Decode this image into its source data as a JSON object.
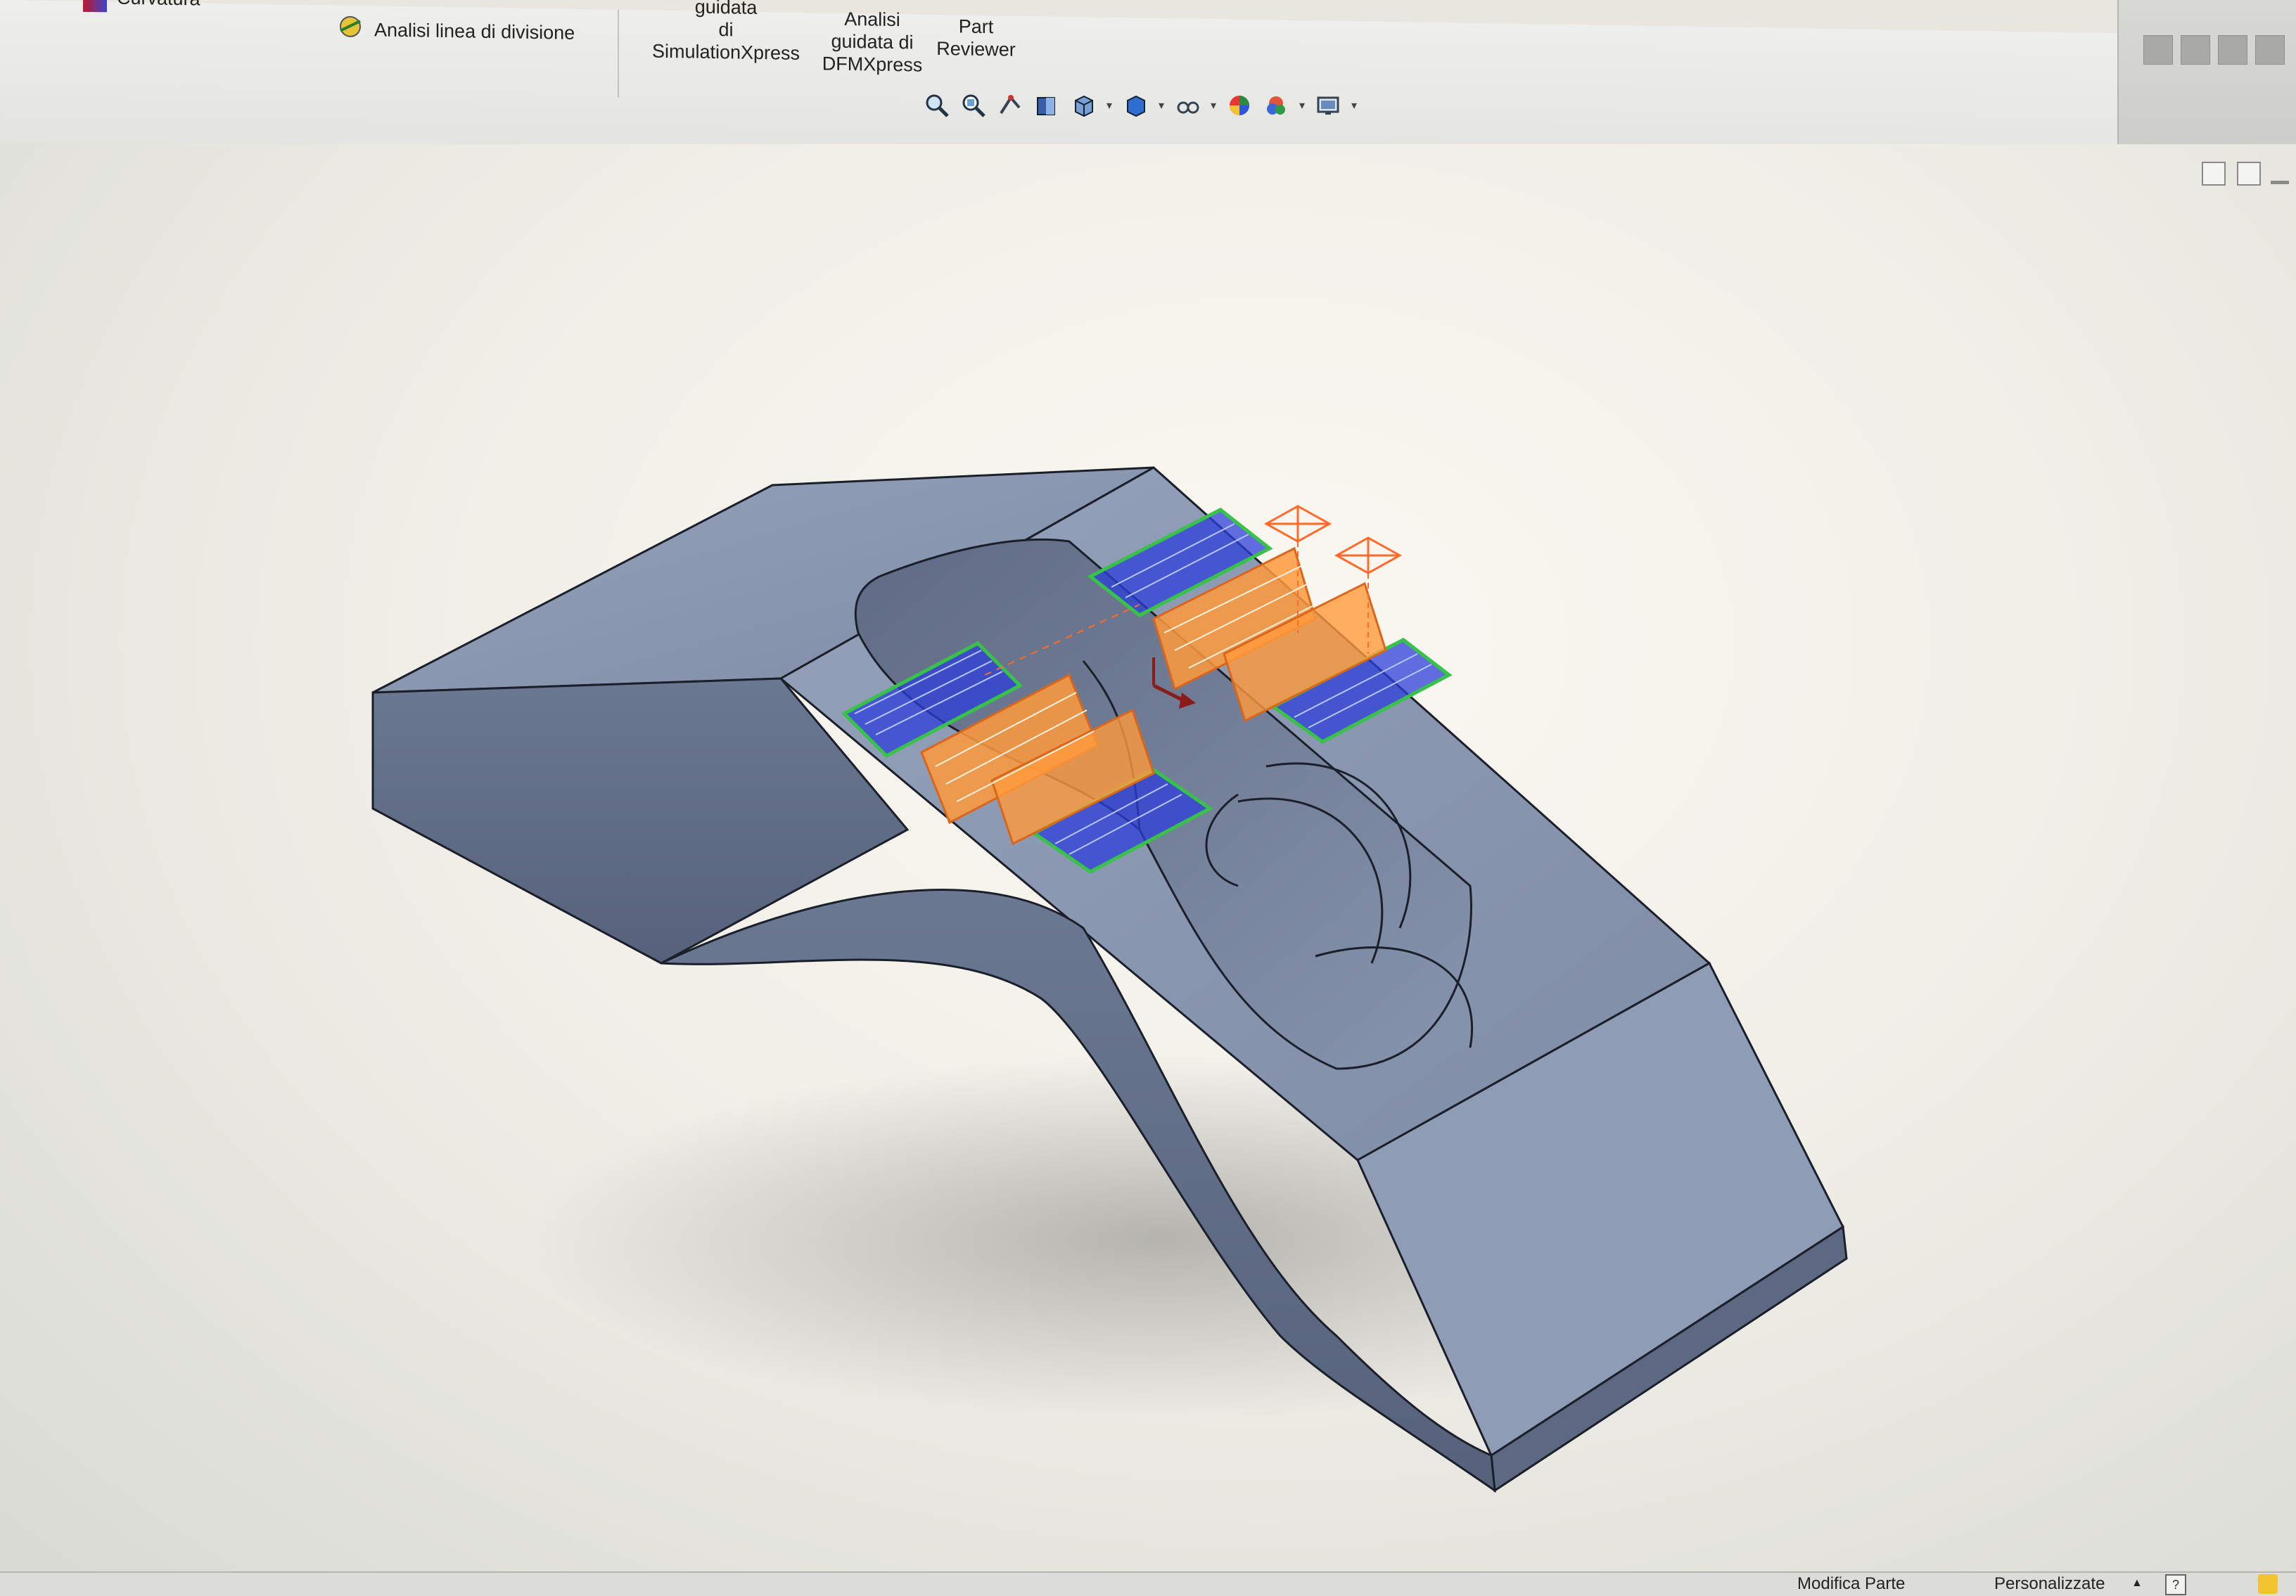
{
  "ribbon": {
    "curvatura": "Curvatura",
    "split_line": "Analisi linea di divisione",
    "simxpress": {
      "line1": "guidata",
      "line2": "di",
      "line3": "SimulationXpress"
    },
    "dfmxpress": {
      "line1": "Analisi",
      "line2": "guidata di",
      "line3": "DFMXpress"
    },
    "part_reviewer": {
      "line1": "Part",
      "line2": "Reviewer"
    }
  },
  "view_toolbar": [
    {
      "name": "zoom-to-fit-icon"
    },
    {
      "name": "zoom-to-area-icon"
    },
    {
      "name": "previous-view-icon"
    },
    {
      "name": "section-view-icon"
    },
    {
      "name": "view-orientation-icon",
      "caret": true
    },
    {
      "name": "display-style-icon",
      "caret": true
    },
    {
      "name": "hide-show-items-icon",
      "caret": true
    },
    {
      "name": "edit-appearance-icon"
    },
    {
      "name": "apply-scene-icon",
      "caret": true
    },
    {
      "name": "view-settings-icon",
      "caret": true
    }
  ],
  "statusbar": {
    "mode": "Modifica Parte",
    "units": "Personalizzate",
    "units_caret": "▲",
    "help": "?"
  },
  "colors": {
    "part_face": "#8e9bb3",
    "part_dark": "#5b6780",
    "toolpath_orange": "#ff9a3c",
    "toolpath_blue": "#1d2fd6",
    "toolpath_green": "#39c24a",
    "accent": "#e9e6df"
  }
}
